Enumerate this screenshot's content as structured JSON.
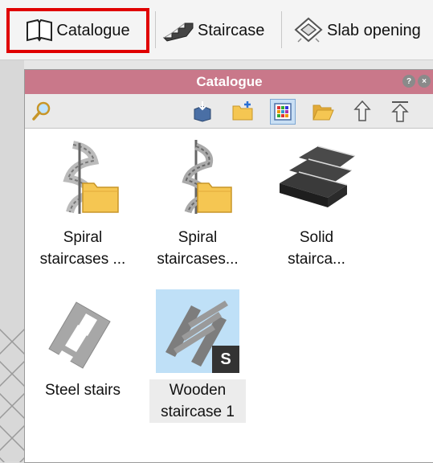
{
  "toolbar": {
    "catalogue_label": "Catalogue",
    "staircase_label": "Staircase",
    "slab_label": "Slab opening"
  },
  "panel": {
    "title": "Catalogue",
    "toolbar_icons": [
      "search-icon",
      "import-icon",
      "new-folder-icon",
      "view-mode-icon",
      "open-folder-icon",
      "up-icon",
      "up-level-icon"
    ]
  },
  "items": [
    {
      "label_line1": "Spiral",
      "label_line2": "staircases ...",
      "icon": "spiral-staircase-folder-icon"
    },
    {
      "label_line1": "Spiral",
      "label_line2": "staircases...",
      "icon": "spiral-staircase-folder-icon"
    },
    {
      "label_line1": "Solid",
      "label_line2": "stairca...",
      "icon": "solid-staircase-icon"
    },
    {
      "label_line1": "Steel stairs",
      "label_line2": "",
      "icon": "steel-stairs-icon"
    },
    {
      "label_line1": "Wooden",
      "label_line2": "staircase 1",
      "icon": "wooden-staircase-icon",
      "badge": "S",
      "selected": true
    }
  ],
  "colors": {
    "highlight": "#e00000",
    "panel_title": "#c9788a",
    "selection": "#bfe0f7"
  }
}
